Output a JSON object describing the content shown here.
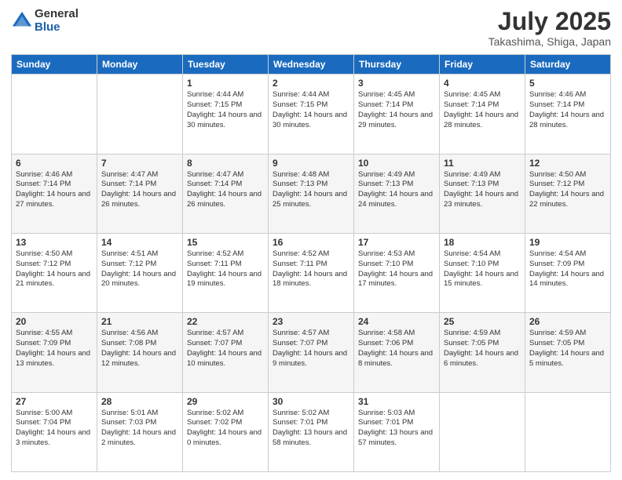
{
  "logo": {
    "general": "General",
    "blue": "Blue"
  },
  "title": "July 2025",
  "location": "Takashima, Shiga, Japan",
  "weekdays": [
    "Sunday",
    "Monday",
    "Tuesday",
    "Wednesday",
    "Thursday",
    "Friday",
    "Saturday"
  ],
  "weeks": [
    [
      {
        "day": "",
        "sunrise": "",
        "sunset": "",
        "daylight": ""
      },
      {
        "day": "",
        "sunrise": "",
        "sunset": "",
        "daylight": ""
      },
      {
        "day": "1",
        "sunrise": "Sunrise: 4:44 AM",
        "sunset": "Sunset: 7:15 PM",
        "daylight": "Daylight: 14 hours and 30 minutes."
      },
      {
        "day": "2",
        "sunrise": "Sunrise: 4:44 AM",
        "sunset": "Sunset: 7:15 PM",
        "daylight": "Daylight: 14 hours and 30 minutes."
      },
      {
        "day": "3",
        "sunrise": "Sunrise: 4:45 AM",
        "sunset": "Sunset: 7:14 PM",
        "daylight": "Daylight: 14 hours and 29 minutes."
      },
      {
        "day": "4",
        "sunrise": "Sunrise: 4:45 AM",
        "sunset": "Sunset: 7:14 PM",
        "daylight": "Daylight: 14 hours and 28 minutes."
      },
      {
        "day": "5",
        "sunrise": "Sunrise: 4:46 AM",
        "sunset": "Sunset: 7:14 PM",
        "daylight": "Daylight: 14 hours and 28 minutes."
      }
    ],
    [
      {
        "day": "6",
        "sunrise": "Sunrise: 4:46 AM",
        "sunset": "Sunset: 7:14 PM",
        "daylight": "Daylight: 14 hours and 27 minutes."
      },
      {
        "day": "7",
        "sunrise": "Sunrise: 4:47 AM",
        "sunset": "Sunset: 7:14 PM",
        "daylight": "Daylight: 14 hours and 26 minutes."
      },
      {
        "day": "8",
        "sunrise": "Sunrise: 4:47 AM",
        "sunset": "Sunset: 7:14 PM",
        "daylight": "Daylight: 14 hours and 26 minutes."
      },
      {
        "day": "9",
        "sunrise": "Sunrise: 4:48 AM",
        "sunset": "Sunset: 7:13 PM",
        "daylight": "Daylight: 14 hours and 25 minutes."
      },
      {
        "day": "10",
        "sunrise": "Sunrise: 4:49 AM",
        "sunset": "Sunset: 7:13 PM",
        "daylight": "Daylight: 14 hours and 24 minutes."
      },
      {
        "day": "11",
        "sunrise": "Sunrise: 4:49 AM",
        "sunset": "Sunset: 7:13 PM",
        "daylight": "Daylight: 14 hours and 23 minutes."
      },
      {
        "day": "12",
        "sunrise": "Sunrise: 4:50 AM",
        "sunset": "Sunset: 7:12 PM",
        "daylight": "Daylight: 14 hours and 22 minutes."
      }
    ],
    [
      {
        "day": "13",
        "sunrise": "Sunrise: 4:50 AM",
        "sunset": "Sunset: 7:12 PM",
        "daylight": "Daylight: 14 hours and 21 minutes."
      },
      {
        "day": "14",
        "sunrise": "Sunrise: 4:51 AM",
        "sunset": "Sunset: 7:12 PM",
        "daylight": "Daylight: 14 hours and 20 minutes."
      },
      {
        "day": "15",
        "sunrise": "Sunrise: 4:52 AM",
        "sunset": "Sunset: 7:11 PM",
        "daylight": "Daylight: 14 hours and 19 minutes."
      },
      {
        "day": "16",
        "sunrise": "Sunrise: 4:52 AM",
        "sunset": "Sunset: 7:11 PM",
        "daylight": "Daylight: 14 hours and 18 minutes."
      },
      {
        "day": "17",
        "sunrise": "Sunrise: 4:53 AM",
        "sunset": "Sunset: 7:10 PM",
        "daylight": "Daylight: 14 hours and 17 minutes."
      },
      {
        "day": "18",
        "sunrise": "Sunrise: 4:54 AM",
        "sunset": "Sunset: 7:10 PM",
        "daylight": "Daylight: 14 hours and 15 minutes."
      },
      {
        "day": "19",
        "sunrise": "Sunrise: 4:54 AM",
        "sunset": "Sunset: 7:09 PM",
        "daylight": "Daylight: 14 hours and 14 minutes."
      }
    ],
    [
      {
        "day": "20",
        "sunrise": "Sunrise: 4:55 AM",
        "sunset": "Sunset: 7:09 PM",
        "daylight": "Daylight: 14 hours and 13 minutes."
      },
      {
        "day": "21",
        "sunrise": "Sunrise: 4:56 AM",
        "sunset": "Sunset: 7:08 PM",
        "daylight": "Daylight: 14 hours and 12 minutes."
      },
      {
        "day": "22",
        "sunrise": "Sunrise: 4:57 AM",
        "sunset": "Sunset: 7:07 PM",
        "daylight": "Daylight: 14 hours and 10 minutes."
      },
      {
        "day": "23",
        "sunrise": "Sunrise: 4:57 AM",
        "sunset": "Sunset: 7:07 PM",
        "daylight": "Daylight: 14 hours and 9 minutes."
      },
      {
        "day": "24",
        "sunrise": "Sunrise: 4:58 AM",
        "sunset": "Sunset: 7:06 PM",
        "daylight": "Daylight: 14 hours and 8 minutes."
      },
      {
        "day": "25",
        "sunrise": "Sunrise: 4:59 AM",
        "sunset": "Sunset: 7:05 PM",
        "daylight": "Daylight: 14 hours and 6 minutes."
      },
      {
        "day": "26",
        "sunrise": "Sunrise: 4:59 AM",
        "sunset": "Sunset: 7:05 PM",
        "daylight": "Daylight: 14 hours and 5 minutes."
      }
    ],
    [
      {
        "day": "27",
        "sunrise": "Sunrise: 5:00 AM",
        "sunset": "Sunset: 7:04 PM",
        "daylight": "Daylight: 14 hours and 3 minutes."
      },
      {
        "day": "28",
        "sunrise": "Sunrise: 5:01 AM",
        "sunset": "Sunset: 7:03 PM",
        "daylight": "Daylight: 14 hours and 2 minutes."
      },
      {
        "day": "29",
        "sunrise": "Sunrise: 5:02 AM",
        "sunset": "Sunset: 7:02 PM",
        "daylight": "Daylight: 14 hours and 0 minutes."
      },
      {
        "day": "30",
        "sunrise": "Sunrise: 5:02 AM",
        "sunset": "Sunset: 7:01 PM",
        "daylight": "Daylight: 13 hours and 58 minutes."
      },
      {
        "day": "31",
        "sunrise": "Sunrise: 5:03 AM",
        "sunset": "Sunset: 7:01 PM",
        "daylight": "Daylight: 13 hours and 57 minutes."
      },
      {
        "day": "",
        "sunrise": "",
        "sunset": "",
        "daylight": ""
      },
      {
        "day": "",
        "sunrise": "",
        "sunset": "",
        "daylight": ""
      }
    ]
  ]
}
